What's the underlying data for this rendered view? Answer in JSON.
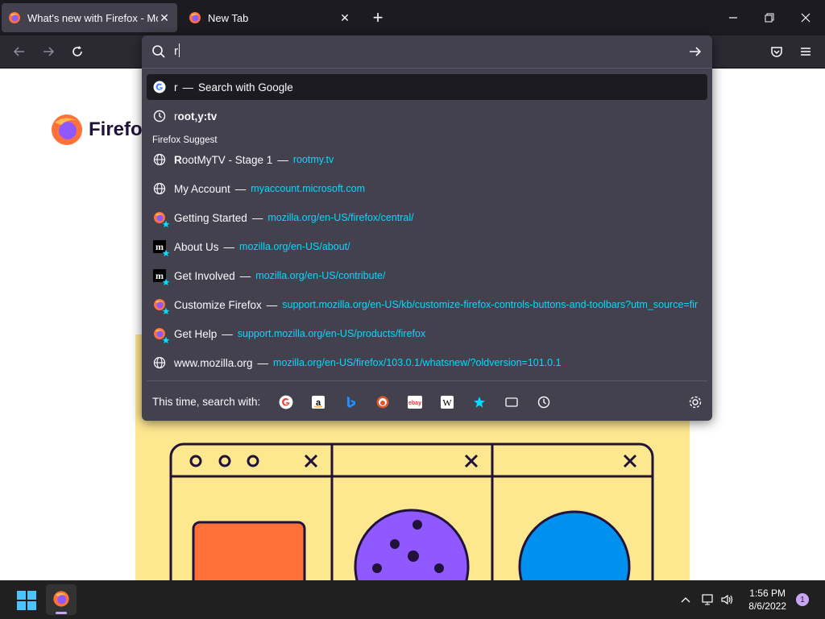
{
  "tabs": [
    {
      "title": "What's new with Firefox - More",
      "active": true
    },
    {
      "title": "New Tab",
      "active": false
    }
  ],
  "urlbar": {
    "typed_value": "r",
    "results": [
      {
        "type": "search",
        "typed": "r",
        "label": "Search with Google",
        "selected": true
      },
      {
        "type": "history",
        "prefix": "r",
        "rest": "oot,y:tv"
      }
    ],
    "suggest_group_label": "Firefox Suggest",
    "suggestions": [
      {
        "icon": "globe-icon",
        "prefix": "R",
        "title": "ootMyTV - Stage 1",
        "url": "rootmy.tv"
      },
      {
        "icon": "globe-icon",
        "prefix": "",
        "title": "My Account",
        "url": "myaccount.microsoft.com"
      },
      {
        "icon": "firefox-bookmark-icon",
        "prefix": "",
        "title": "Getting Started",
        "url": "mozilla.org/en-US/firefox/central/"
      },
      {
        "icon": "mozilla-bookmark-icon",
        "prefix": "",
        "title": "About Us",
        "url": "mozilla.org/en-US/about/"
      },
      {
        "icon": "mozilla-bookmark-icon",
        "prefix": "",
        "title": "Get Involved",
        "url": "mozilla.org/en-US/contribute/"
      },
      {
        "icon": "firefox-bookmark-icon",
        "prefix": "",
        "title": "Customize Firefox",
        "url": "support.mozilla.org/en-US/kb/customize-firefox-controls-buttons-and-toolbars?utm_source=fir"
      },
      {
        "icon": "firefox-bookmark-icon",
        "prefix": "",
        "title": "Get Help",
        "url": "support.mozilla.org/en-US/products/firefox"
      },
      {
        "icon": "globe-icon",
        "prefix": "",
        "title": "www.mozilla.org",
        "url": "mozilla.org/en-US/firefox/103.0.1/whatsnew/?oldversion=101.0.1"
      }
    ],
    "one_off_label": "This time, search with:",
    "one_off_engines": [
      "google-icon",
      "amazon-icon",
      "bing-icon",
      "duckduckgo-icon",
      "ebay-icon",
      "wikipedia-icon",
      "bookmarks-icon",
      "tabs-icon",
      "history-icon"
    ]
  },
  "page": {
    "wordmark": "Firefox"
  },
  "taskbar": {
    "time": "1:56 PM",
    "date": "8/6/2022",
    "notification_count": "1"
  },
  "colors": {
    "tabstrip": "#1c1b22",
    "toolbar": "#2b2a33",
    "dropdown": "#42414d",
    "url_accent": "#00ddff",
    "hero": "#fde78f"
  }
}
